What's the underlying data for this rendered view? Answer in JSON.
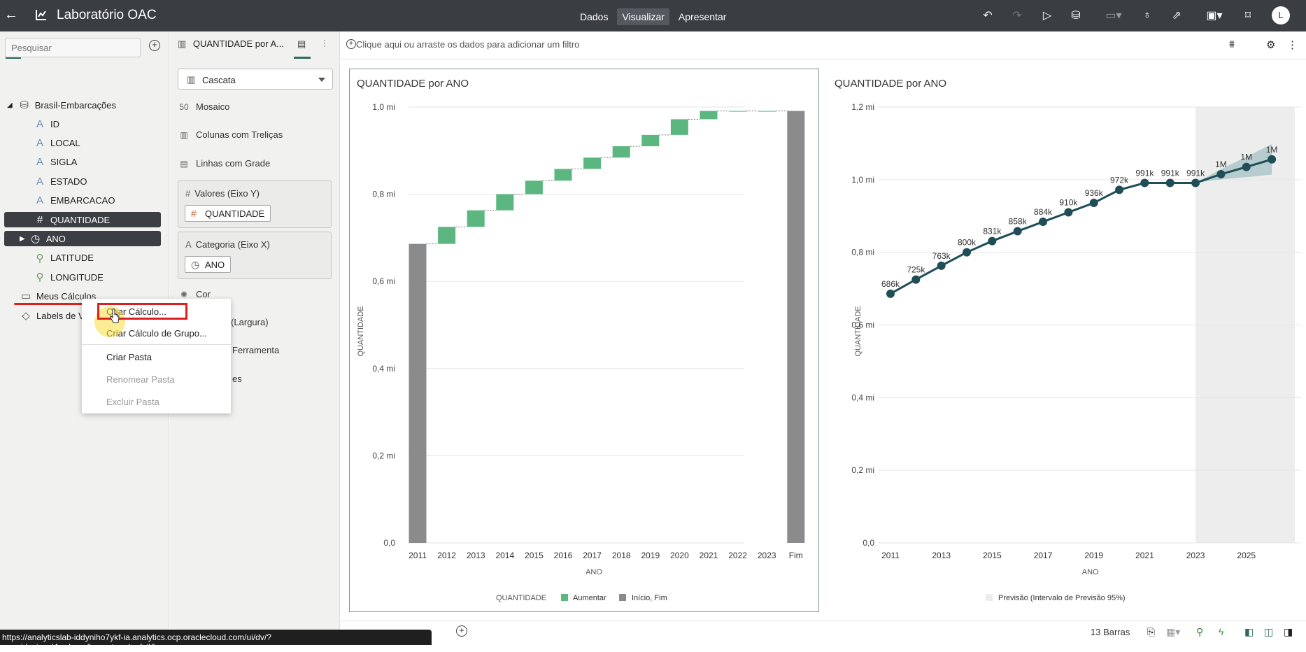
{
  "topbar": {
    "title": "Laboratório OAC",
    "modes": [
      "Dados",
      "Visualizar",
      "Apresentar"
    ],
    "active_mode": "Visualizar",
    "avatar": "L"
  },
  "left_panel": {
    "search_placeholder": "Pesquisar",
    "dataset": "Brasil-Embarcações",
    "fields": [
      {
        "label": "ID",
        "type": "text"
      },
      {
        "label": "LOCAL",
        "type": "text"
      },
      {
        "label": "SIGLA",
        "type": "text"
      },
      {
        "label": "ESTADO",
        "type": "text"
      },
      {
        "label": "EMBARCACAO",
        "type": "text"
      },
      {
        "label": "QUANTIDADE",
        "type": "number"
      },
      {
        "label": "ANO",
        "type": "time"
      },
      {
        "label": "LATITUDE",
        "type": "geo"
      },
      {
        "label": "LONGITUDE",
        "type": "geo"
      }
    ],
    "folders": [
      "Meus Cálculos",
      "Labels de V"
    ]
  },
  "context_menu": {
    "items": [
      "Criar Cálculo...",
      "Criar Cálculo de Grupo...",
      "Criar Pasta",
      "Renomear Pasta",
      "Excluir Pasta"
    ],
    "disabled": [
      "Renomear Pasta",
      "Excluir Pasta"
    ]
  },
  "grammar_panel": {
    "tab_label": "QUANTIDADE por A...",
    "viz_type": "Cascata",
    "items": [
      "Mosaico",
      "Colunas com Treliças",
      "Linhas com Grade"
    ],
    "values_label": "Valores (Eixo Y)",
    "values_pill": "QUANTIDADE",
    "category_label": "Categoria (Eixo X)",
    "category_pill": "ANO",
    "more": [
      "Cor",
      "no (Largura)",
      "Ferramenta",
      "es"
    ]
  },
  "filterbar": {
    "placeholder": "Clique aqui ou arraste os dados para adicionar um filtro"
  },
  "bottombar": {
    "count": "13 Barras"
  },
  "status_url": "https://analyticslab-iddyniho7ykf-ia.analytics.ocp.oraclecloud.com/ui/dv/?pageid=visualAnalyzer&reportmode=full&...",
  "chart_data": [
    {
      "type": "bar",
      "subtype": "waterfall",
      "title": "QUANTIDADE por ANO",
      "xlabel": "ANO",
      "ylabel": "QUANTIDADE",
      "categories": [
        "2011",
        "2012",
        "2013",
        "2014",
        "2015",
        "2016",
        "2017",
        "2018",
        "2019",
        "2020",
        "2021",
        "2022",
        "2023",
        "Fim"
      ],
      "values": [
        686,
        725,
        763,
        800,
        831,
        858,
        884,
        910,
        936,
        972,
        991,
        991,
        991,
        991
      ],
      "unit": "mil",
      "yticks": [
        "0,0",
        "0,2 mi",
        "0,4 mi",
        "0,6 mi",
        "0,8 mi",
        "1,0 mi"
      ],
      "ylim": [
        0,
        1000
      ],
      "legend": {
        "title": "QUANTIDADE",
        "items": [
          "Aumentar",
          "Início, Fim"
        ]
      },
      "colors": {
        "increase": "#5bb67f",
        "total": "#8a8b8c"
      }
    },
    {
      "type": "line",
      "title": "QUANTIDADE por ANO",
      "xlabel": "ANO",
      "ylabel": "QUANTIDADE",
      "x": [
        2011,
        2012,
        2013,
        2014,
        2015,
        2016,
        2017,
        2018,
        2019,
        2020,
        2021,
        2022,
        2023,
        2024,
        2025,
        2026
      ],
      "values": [
        686,
        725,
        763,
        800,
        831,
        858,
        884,
        910,
        936,
        972,
        991,
        991,
        991,
        1015,
        1035,
        1056
      ],
      "labels": [
        "686k",
        "725k",
        "763k",
        "800k",
        "831k",
        "858k",
        "884k",
        "910k",
        "936k",
        "972k",
        "991k",
        "991k",
        "991k",
        "1M",
        "1M",
        "1M"
      ],
      "forecast_from": 2023,
      "xticks": [
        "2011",
        "2013",
        "2015",
        "2017",
        "2019",
        "2021",
        "2023",
        "2025"
      ],
      "yticks": [
        "0,0",
        "0,2 mi",
        "0,4 mi",
        "0,6 mi",
        "0,8 mi",
        "1,0 mi",
        "1,2 mi"
      ],
      "ylim": [
        0,
        1200
      ],
      "legend": {
        "items": [
          "Previsão (Intervalo de Previsão 95%)"
        ]
      },
      "colors": {
        "line": "#1f4e57",
        "band": "#a9c3c7"
      }
    }
  ]
}
